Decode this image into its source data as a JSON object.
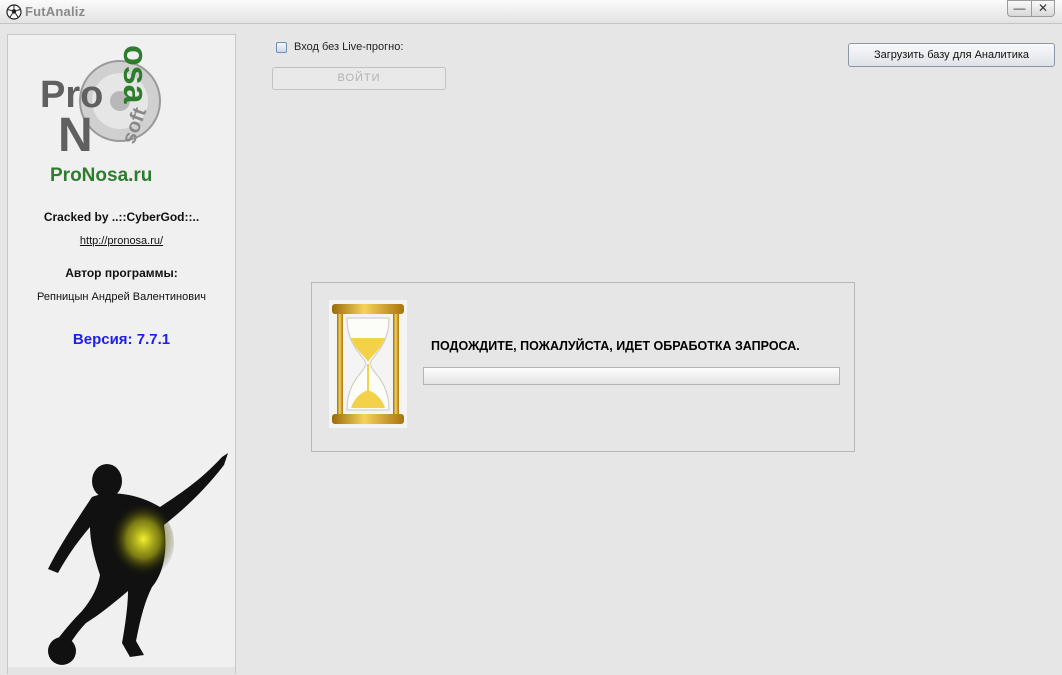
{
  "window": {
    "title": "FutAnaliz",
    "minimize_glyph": "—",
    "close_glyph": "✕"
  },
  "sidebar": {
    "logo": {
      "brand_text": "ProNosa.ru",
      "mark_letters": [
        "Pro",
        "N",
        "osa",
        "soft"
      ]
    },
    "cracked_by": "Cracked by ..::CyberGod::..",
    "link": "http://pronosa.ru/",
    "author_label": "Автор программы:",
    "author_name": "Репницын Андрей Валентинович",
    "version": "Версия: 7.7.1"
  },
  "main": {
    "live_checkbox": {
      "label": "Вход без Live-прогно:",
      "checked": false
    },
    "login_button": {
      "label": "ВОЙТИ",
      "enabled": false
    },
    "load_db_button": {
      "label": "Загрузить базу для Аналитика"
    },
    "wait_panel": {
      "message": "ПОДОЖДИТЕ, ПОЖАЛУЙСТА, ИДЕТ ОБРАБОТКА ЗАПРОСА.",
      "progress": 0
    }
  },
  "colors": {
    "version_text": "#1e1ee6",
    "logo_green": "#2e7d2e",
    "logo_grey": "#606060",
    "hourglass_gold": "#e8b020",
    "sand": "#f3d24a",
    "player_glow": "#d8d820"
  },
  "icons": [
    "soccer-ball-icon",
    "hourglass-icon",
    "player-silhouette",
    "pronosa-logo"
  ]
}
